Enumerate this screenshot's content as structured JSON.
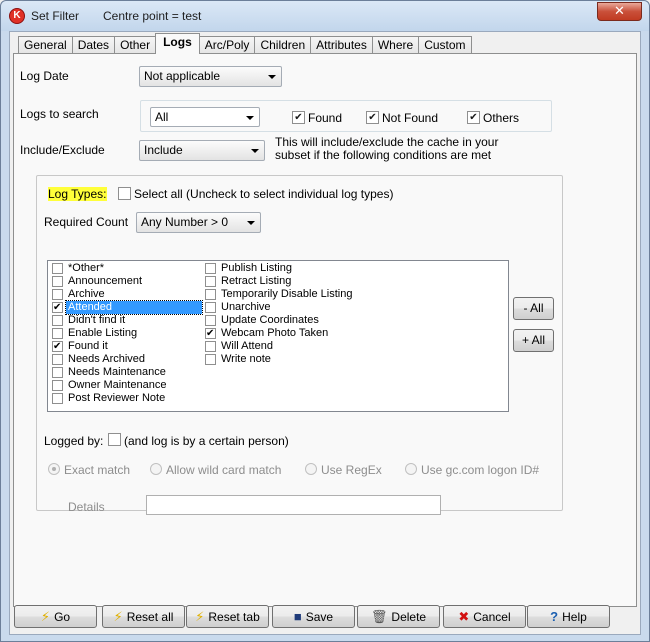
{
  "window": {
    "title": "Set Filter",
    "subtitle": "Centre point = test",
    "close_label": "✕"
  },
  "tabs": [
    "General",
    "Dates",
    "Other",
    "Logs",
    "Arc/Poly",
    "Children",
    "Attributes",
    "Where",
    "Custom"
  ],
  "active_tab": "Logs",
  "log_date": {
    "label": "Log Date",
    "value": "Not applicable"
  },
  "logs_to_search": {
    "label": "Logs to search",
    "value": "All",
    "found_label": "Found",
    "found_checked": true,
    "not_found_label": "Not Found",
    "not_found_checked": true,
    "others_label": "Others",
    "others_checked": true
  },
  "include_exclude": {
    "label": "Include/Exclude",
    "value": "Include",
    "help": "This will include/exclude the cache in your subset if the following conditions are met"
  },
  "log_types": {
    "label": "Log Types:",
    "select_all_label": "Select all (Uncheck to select individual log types)",
    "select_all_checked": false
  },
  "required_count": {
    "label": "Required Count",
    "value": "Any Number > 0"
  },
  "log_type_list": {
    "col1": [
      {
        "label": "*Other*",
        "checked": false
      },
      {
        "label": "Announcement",
        "checked": false
      },
      {
        "label": "Archive",
        "checked": false
      },
      {
        "label": "Attended",
        "checked": true,
        "selected": true
      },
      {
        "label": "Didn't find it",
        "checked": false
      },
      {
        "label": "Enable Listing",
        "checked": false
      },
      {
        "label": "Found it",
        "checked": true
      },
      {
        "label": "Needs Archived",
        "checked": false
      },
      {
        "label": "Needs Maintenance",
        "checked": false
      },
      {
        "label": "Owner Maintenance",
        "checked": false
      },
      {
        "label": "Post Reviewer Note",
        "checked": false
      }
    ],
    "col2": [
      {
        "label": "Publish Listing",
        "checked": false
      },
      {
        "label": "Retract Listing",
        "checked": false
      },
      {
        "label": "Temporarily Disable Listing",
        "checked": false
      },
      {
        "label": "Unarchive",
        "checked": false
      },
      {
        "label": "Update Coordinates",
        "checked": false
      },
      {
        "label": "Webcam Photo Taken",
        "checked": true
      },
      {
        "label": "Will Attend",
        "checked": false
      },
      {
        "label": "Write note",
        "checked": false
      }
    ]
  },
  "side_buttons": {
    "minus_all": "- All",
    "plus_all": "+ All"
  },
  "logged_by": {
    "label": "Logged by:",
    "check_label": "(and log is by a certain person)",
    "checked": false,
    "options": [
      "Exact match",
      "Allow wild card match",
      "Use RegEx",
      "Use gc.com logon ID#"
    ],
    "selected_option": "Exact match",
    "details_label": "Details",
    "details_value": ""
  },
  "footer_buttons": {
    "go": "Go",
    "reset_all": "Reset all",
    "reset_tab": "Reset tab",
    "save": "Save",
    "delete": "Delete",
    "cancel": "Cancel",
    "help": "Help"
  },
  "colors": {
    "highlight": "#ffff3a",
    "selection": "#3399ff",
    "close": "#c13b22"
  }
}
